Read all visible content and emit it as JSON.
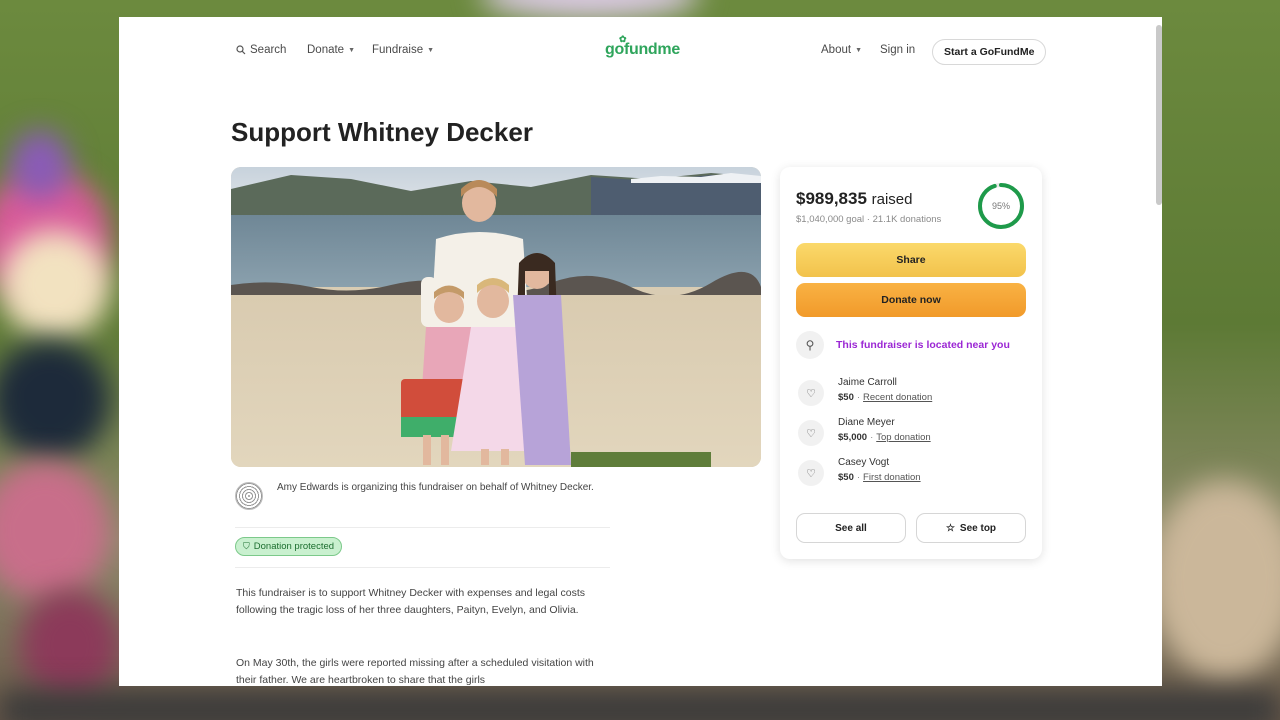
{
  "nav": {
    "search_label": "Search",
    "donate_label": "Donate",
    "fundraise_label": "Fundraise",
    "logo_text": "gofundme",
    "about_label": "About",
    "signin_label": "Sign in",
    "start_label": "Start a GoFundMe"
  },
  "page_title": "Support Whitney Decker",
  "organizer": {
    "text": "Amy Edwards is organizing this fundraiser on behalf of Whitney Decker."
  },
  "badge": {
    "label": "Donation protected"
  },
  "story": {
    "paragraph1": "This fundraiser is to support Whitney Decker with expenses and legal costs following the tragic loss of her three daughters, Paityn, Evelyn, and Olivia.",
    "paragraph2": "On May 30th, the girls were reported missing after a scheduled visitation with their father. We are heartbroken to share that the girls"
  },
  "card": {
    "raised_amount": "$989,835",
    "raised_word": "raised",
    "goal_text": "$1,040,000 goal · 21.1K donations",
    "progress_label": "95%",
    "progress_fraction": 0.95,
    "share_label": "Share",
    "donate_label": "Donate now",
    "nearby_text": "This fundraiser is located near you",
    "donors": [
      {
        "name": "Jaime Carroll",
        "amount": "$50",
        "tag": "Recent donation"
      },
      {
        "name": "Diane Meyer",
        "amount": "$5,000",
        "tag": "Top donation"
      },
      {
        "name": "Casey Vogt",
        "amount": "$50",
        "tag": "First donation"
      }
    ],
    "see_all_label": "See all",
    "see_top_label": "See top"
  },
  "colors": {
    "brand_green": "#2fa55c",
    "share_yellow": "#f2c24b",
    "donate_orange": "#f19a2a",
    "nearby_purple": "#9b27d4",
    "badge_green": "#c9f0cf"
  },
  "icons": {
    "search": "search-icon",
    "star": "star-icon",
    "shield": "shield-icon",
    "heart": "heart-icon",
    "location": "location-pin-icon"
  }
}
